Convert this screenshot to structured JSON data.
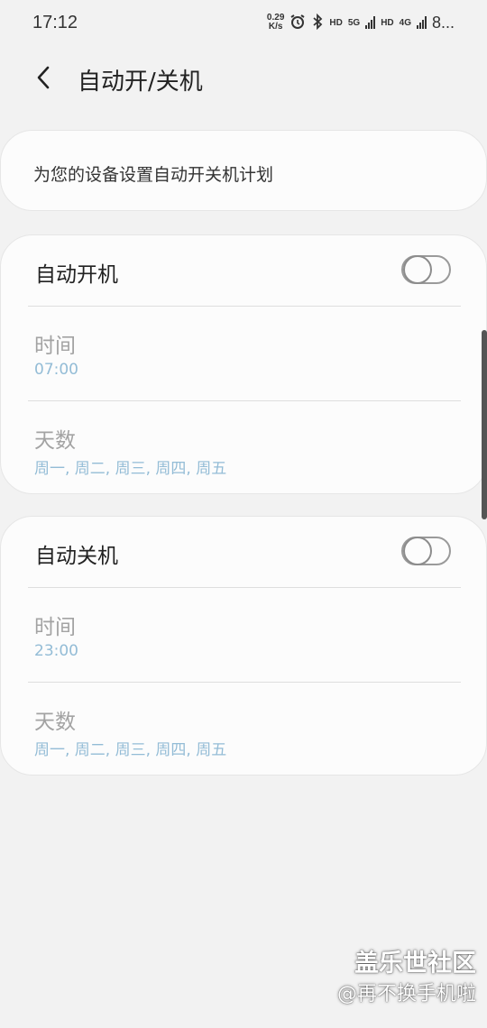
{
  "status_bar": {
    "time": "17:12",
    "speed_value": "0.29",
    "speed_unit": "K/s",
    "hd1": "HD",
    "net1": "5G",
    "hd2": "HD",
    "net2": "4G",
    "battery": "8..."
  },
  "header": {
    "title": "自动开/关机",
    "back_icon": "chevron-left-icon"
  },
  "info": {
    "text": "为您的设备设置自动开关机计划"
  },
  "power_on": {
    "title": "自动开机",
    "enabled": false,
    "time_label": "时间",
    "time_value": "07:00",
    "days_label": "天数",
    "days_value": "周一, 周二, 周三, 周四, 周五"
  },
  "power_off": {
    "title": "自动关机",
    "enabled": false,
    "time_label": "时间",
    "time_value": "23:00",
    "days_label": "天数",
    "days_value": "周一, 周二, 周三, 周四, 周五"
  },
  "watermark": {
    "line1": "盖乐世社区",
    "line2": "@再不换手机啦"
  },
  "colors": {
    "background": "#f2f2f2",
    "card": "#fcfcfc",
    "value_blue": "#93bcd6",
    "label_gray": "#a3a3a3"
  }
}
